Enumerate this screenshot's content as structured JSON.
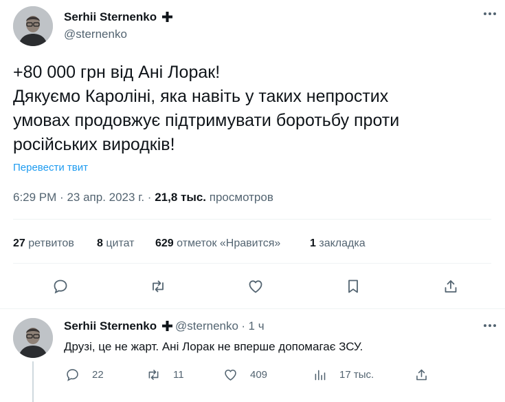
{
  "tweet": {
    "author_name": "Serhii Sternenko",
    "badge_icon": "cross-icon",
    "handle": "@sternenko",
    "text_lines": [
      "+80 000 грн від Ані Лорак!",
      "Дякуємо Кароліні, яка навіть у таких непростих",
      "умовах продовжує підтримувати боротьбу проти",
      "російських виродків!"
    ],
    "translate_label": "Перевести твит",
    "time": "6:29 PM",
    "date": "23 апр. 2023 г.",
    "separator": "·",
    "views_count": "21,8 тыс.",
    "views_label": "просмотров",
    "stats": {
      "retweets_count": "27",
      "retweets_label": "ретвитов",
      "quotes_count": "8",
      "quotes_label": "цитат",
      "likes_count": "629",
      "likes_label": "отметок «Нравится»",
      "bookmarks_count": "1",
      "bookmarks_label": "закладка"
    },
    "actions": [
      "reply-icon",
      "retweet-icon",
      "like-icon",
      "bookmark-icon",
      "share-icon"
    ]
  },
  "reply": {
    "author_name": "Serhii Sternenko",
    "badge_icon": "cross-icon",
    "handle": "@sternenko",
    "separator": "·",
    "time_ago": "1 ч",
    "text": "Друзі, це не жарт. Ані Лорак не вперше допомагає ЗСУ.",
    "replies": "22",
    "retweets": "11",
    "likes": "409",
    "views": "17 тыс."
  },
  "colors": {
    "text": "#0f1419",
    "muted": "#536471",
    "link": "#1d9bf0",
    "divider": "#eff3f4"
  }
}
